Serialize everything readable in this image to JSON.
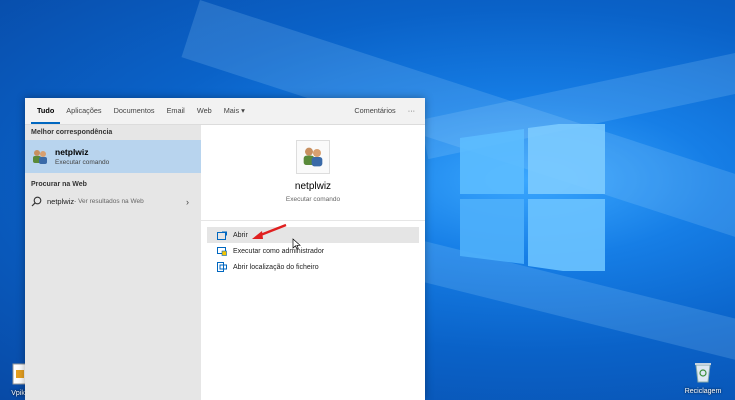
{
  "tabs": [
    {
      "label": "Tudo",
      "active": true
    },
    {
      "label": "Aplicações"
    },
    {
      "label": "Documentos"
    },
    {
      "label": "Email"
    },
    {
      "label": "Web"
    },
    {
      "label": "Mais ▾"
    }
  ],
  "feedback_label": "Comentários",
  "more_options_label": "···",
  "left": {
    "best_match_title": "Melhor correspondência",
    "best_match": {
      "name": "netplwiz",
      "subtitle": "Executar comando",
      "icon": "users-icon"
    },
    "web_title": "Procurar na Web",
    "web_result": {
      "query": "netplwiz",
      "suffix": " - Ver resultados na Web",
      "icon": "search-icon",
      "chevron": "›"
    }
  },
  "right": {
    "name": "netplwiz",
    "subtitle": "Executar comando",
    "actions": [
      {
        "label": "Abrir",
        "icon": "open-icon",
        "highlight": true
      },
      {
        "label": "Executar como administrador",
        "icon": "admin-icon"
      },
      {
        "label": "Abrir localização do ficheiro",
        "icon": "folder-location-icon"
      }
    ]
  },
  "desktop": {
    "recycle_bin_label": "Reciclagem",
    "left_icon_label": "Vpike"
  },
  "colors": {
    "accent": "#0067c0",
    "selection": "#b8d4ee",
    "arrow": "#e02020"
  }
}
